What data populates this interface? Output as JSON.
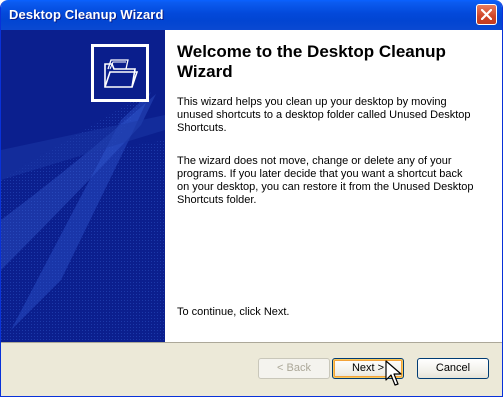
{
  "window": {
    "title": "Desktop Cleanup Wizard",
    "close_icon": "close-icon"
  },
  "side_panel": {
    "icon": "folder-icon"
  },
  "content": {
    "heading": "Welcome to the Desktop Cleanup Wizard",
    "paragraph1": "This wizard helps you clean up your desktop by moving unused shortcuts to a desktop folder called Unused Desktop Shortcuts.",
    "paragraph2": "The wizard does not move, change or delete any of your programs. If you later decide that you want a shortcut back on your desktop, you can restore it from the Unused Desktop Shortcuts folder.",
    "continue_text": "To continue, click Next."
  },
  "buttons": {
    "back": "< Back",
    "next": "Next >",
    "cancel": "Cancel"
  },
  "colors": {
    "titlebar": "#0349da",
    "side_panel": "#0a1e8c",
    "dialog_face": "#ece9d8"
  }
}
